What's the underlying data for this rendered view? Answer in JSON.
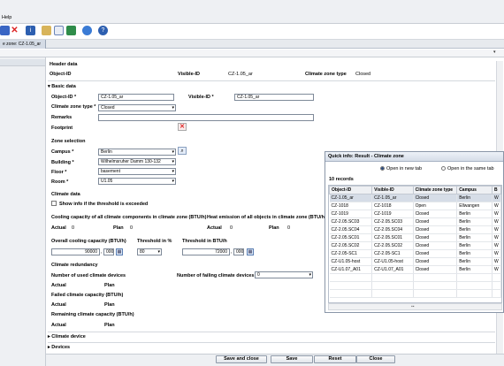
{
  "menu": {
    "help": "Help"
  },
  "toolbar": {
    "icons": [
      "save-icon",
      "delete-icon",
      "info-icon",
      "broom-icon",
      "edit-document-icon",
      "share-icon",
      "refresh-icon",
      "help-icon"
    ]
  },
  "tab": {
    "label": "e zone: CZ-1.05_ar"
  },
  "header": {
    "section_title": "Header data",
    "object_id_label": "Object-ID",
    "visible_id_label": "Visible-ID",
    "visible_id_value": "CZ-1.05_ar",
    "climate_zone_type_label": "Climate zone type",
    "climate_zone_type_value": "Closed"
  },
  "basic": {
    "section_title": "Basic data",
    "object_id_label": "Object-ID *",
    "object_id_value": "CZ-1.05_ar",
    "visible_id_label": "Visible-ID *",
    "visible_id_value": "CZ-1.05_ar",
    "climate_type_label": "Climate zone type *",
    "climate_type_value": "Closed",
    "remarks_label": "Remarks",
    "footprint_label": "Footprint"
  },
  "zone": {
    "section_title": "Zone selection",
    "campus_label": "Campus *",
    "campus_value": "Berlin",
    "building_label": "Building *",
    "building_value": "Wilhelmsruher Damm 130-132",
    "floor_label": "Floor *",
    "floor_value": "basement",
    "room_label": "Room *",
    "room_value": "U1.05"
  },
  "climate": {
    "section_title": "Climate data",
    "show_info_label": "Show info if the threshold is exceeded",
    "cooling_cap_label": "Cooling capacity of all climate components in climate zone (BTU/h)",
    "heat_emission_label": "Heat emission of all objects in climate zone (BTU/h)",
    "actual_label": "Actual",
    "actual_value": "0",
    "plan_label": "Plan",
    "plan_value": "0",
    "actual2_label": "Actual",
    "actual2_value": "0",
    "plan2_label": "Plan",
    "plan2_value": "0",
    "overall_label": "Overall cooling capacity (BTU/h)",
    "overall_value": "90000",
    "overall_dec": "000",
    "threshold_pct_label": "Threshold in %",
    "threshold_pct_value": "80",
    "threshold_btu_label": "Threshold in BTU/h",
    "threshold_btu_value": "72000",
    "threshold_btu_dec": "000"
  },
  "redundancy": {
    "section_title": "Climate redundancy",
    "used_label": "Number of used climate devices",
    "failing_label": "Number of failing climate devices",
    "failing_value": "0",
    "actual_label": "Actual",
    "plan_label": "Plan",
    "failed_cap_label": "Failed climate capacity (BTU/h)",
    "actual2_label": "Actual",
    "plan2_label": "Plan",
    "remaining_label": "Remaining climate capacity (BTU/h)",
    "actual3_label": "Actual",
    "plan3_label": "Plan"
  },
  "collapsed": {
    "climate_device": "Climate device",
    "devices": "Devices"
  },
  "buttons": {
    "save_close": "Save and close",
    "save": "Save",
    "reset": "Reset",
    "close": "Close"
  },
  "quickinfo": {
    "title": "Quick info: Result - Climate zone",
    "open_new_tab": "Open in new tab",
    "open_same_tab": "Open in the same tab",
    "records": "10 records",
    "columns": [
      "Object-ID",
      "Visible-ID",
      "Climate zone type",
      "Campus",
      "B"
    ],
    "rows": [
      [
        "CZ-1.05_ar",
        "CZ-1.05_ar",
        "Closed",
        "Berlin",
        "W"
      ],
      [
        "CZ-1018",
        "CZ-1018",
        "Open",
        "Ellwangen",
        "W"
      ],
      [
        "CZ-1019",
        "CZ-1019",
        "Closed",
        "Berlin",
        "W"
      ],
      [
        "CZ-2.05.SC03",
        "CZ-2.05.SC03",
        "Closed",
        "Berlin",
        "W"
      ],
      [
        "CZ-2.05.SC04",
        "CZ-2.05.SC04",
        "Closed",
        "Berlin",
        "W"
      ],
      [
        "CZ-2.05.SC01",
        "CZ-2.05.SC01",
        "Closed",
        "Berlin",
        "W"
      ],
      [
        "CZ-2.05.SC02",
        "CZ-2.05.SC02",
        "Closed",
        "Berlin",
        "W"
      ],
      [
        "CZ-2.05-SC1",
        "CZ-2.05-SC1",
        "Closed",
        "Berlin",
        "W"
      ],
      [
        "CZ-U1.05-host",
        "CZ-U1.05-host",
        "Closed",
        "Berlin",
        "W"
      ],
      [
        "CZ-U1.07_A01",
        "CZ-U1.07_A01",
        "Closed",
        "Berlin",
        "W"
      ]
    ]
  }
}
